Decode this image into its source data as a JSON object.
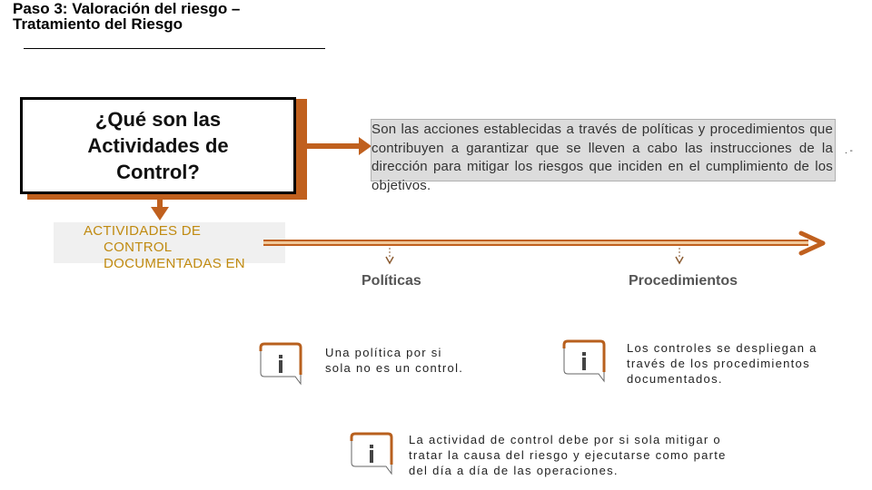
{
  "title": {
    "line1": "Paso 3: Valoración del riesgo –",
    "line2": "Tratamiento del Riesgo"
  },
  "question": {
    "line1": "¿Qué son las",
    "line2": "Actividades de",
    "line3": "Control?"
  },
  "definition": "Son las acciones establecidas a través de políticas y procedimientos que contribuyen a garantizar que se lleven a cabo las instrucciones de la dirección para mitigar los riesgos que inciden en el cumplimiento de los objetivos.",
  "side_mark": ". -",
  "documented": {
    "line1": "ACTIVIDADES DE",
    "line2": "CONTROL",
    "line3": "DOCUMENTADAS EN"
  },
  "categories": [
    {
      "label": "Políticas"
    },
    {
      "label": "Procedimientos"
    }
  ],
  "notes": [
    {
      "icon": "info-icon",
      "text": "Una política por si sola no es un control."
    },
    {
      "icon": "info-icon",
      "text": "Los controles se despliegan a través de los procedimientos documentados."
    },
    {
      "icon": "info-icon",
      "text": "La actividad de control debe por si sola mitigar o tratar la causa del riesgo y ejecutarse como parte del día a día de las operaciones."
    }
  ],
  "colors": {
    "accent": "#c0601e",
    "label_gold": "#c08a10",
    "definition_bg": "#dcdcdc"
  }
}
